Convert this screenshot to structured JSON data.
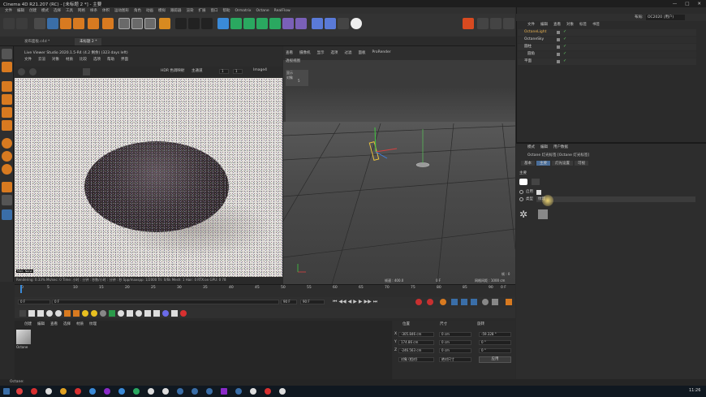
{
  "window": {
    "title": "Cinema 4D R21.207 (RC) - [未标题 2 *] - 主要"
  },
  "menu": [
    "文件",
    "编辑",
    "创建",
    "模式",
    "选择",
    "工具",
    "网格",
    "样条",
    "体积",
    "运动图形",
    "角色",
    "动画",
    "模拟",
    "跟踪器",
    "渲染",
    "扩展",
    "窗口",
    "帮助",
    "Ormatrix",
    "Octane",
    "RealFlow"
  ],
  "tabs": [
    "发布面板.c4d *",
    "未标题 2 *"
  ],
  "liveviewer": {
    "title": "Live Viewer Studio 2020.1.5-R4 (4.2 剩余) (323 days left)",
    "menu": [
      "文件",
      "云渲",
      "对象",
      "材质",
      "比较",
      "选项",
      "帮助",
      "界面"
    ],
    "hdr": "HDR 色调映射",
    "channel": "主通道",
    "num1": "1",
    "num2": "1",
    "image": "Image4",
    "status": "Rendering: 0.33%  Ms/sec: 0  Time: 小时 : 分钟 : 秒数/小时 : 分钟 : 秒  Spp/maxspp: 1/2000  Tri: 0/6k  Mesh: 1  Hair: 0  RTX:on  GPU: 0  78",
    "badge": "Main Noise"
  },
  "viewport": {
    "menu": [
      "查看",
      "摄像机",
      "显示",
      "选项",
      "过滤",
      "面板",
      "ProRender"
    ],
    "label": "透视视图",
    "hud_a": "显示",
    "hud_b": "对象",
    "hud_c": "5",
    "distance": "帧速 : 400.0",
    "frame": "0 F",
    "grid": "网格间距 : 1000 cm",
    "corner": "帧 : 0"
  },
  "timeline": {
    "ticks": [
      "0",
      "5",
      "10",
      "15",
      "20",
      "25",
      "30",
      "35",
      "40",
      "45",
      "50",
      "55",
      "60",
      "65",
      "70",
      "75",
      "80",
      "85",
      "90"
    ],
    "start": "0 F",
    "cur": "0 F",
    "end": "90 F",
    "end2": "90 F",
    "end_right": "0 F"
  },
  "materials": {
    "menu": [
      "创建",
      "编辑",
      "查看",
      "选择",
      "材质",
      "纹理"
    ],
    "item": "Octane"
  },
  "coords": {
    "headers": [
      "位置",
      "尺寸",
      "旋转"
    ],
    "x": "-305.846 cm",
    "y": "174.86 cm",
    "z": "-246.563 cm",
    "sx": "0 cm",
    "sy": "0 cm",
    "sz": "0 cm",
    "h": "-59.328 °",
    "p": "0 °",
    "b": "0 °",
    "mode1": "对象 (相对)",
    "mode2": "绝对尺寸",
    "apply": "应用"
  },
  "right": {
    "top_menu": [
      "文件",
      "编辑",
      "查看",
      "对象",
      "标签",
      "书签"
    ],
    "layout_label": "布局:",
    "layout_value": "OC2020 (用户)",
    "objects": [
      {
        "name": "OctaneLight",
        "color": "#e6b050"
      },
      {
        "name": "OctaneSky",
        "color": "#d0d0d0"
      },
      {
        "name": "圆柱",
        "color": "#d0d0d0"
      },
      {
        "name": "圆角",
        "color": "#d0d0d0"
      },
      {
        "name": "平面",
        "color": "#d0d0d0"
      }
    ],
    "attr_menu": [
      "模式",
      "编辑",
      "用户数据"
    ],
    "attr_title": "Octane 灯光标签 [Octane 灯光标签]",
    "attr_tabs": [
      "基本",
      "主要",
      "灯光设置",
      "可视"
    ],
    "attr_section": "主要",
    "field1": "类型",
    "field2": "启用",
    "field3": "纹理"
  },
  "statusbar": "Octane:",
  "clock": "11:26"
}
